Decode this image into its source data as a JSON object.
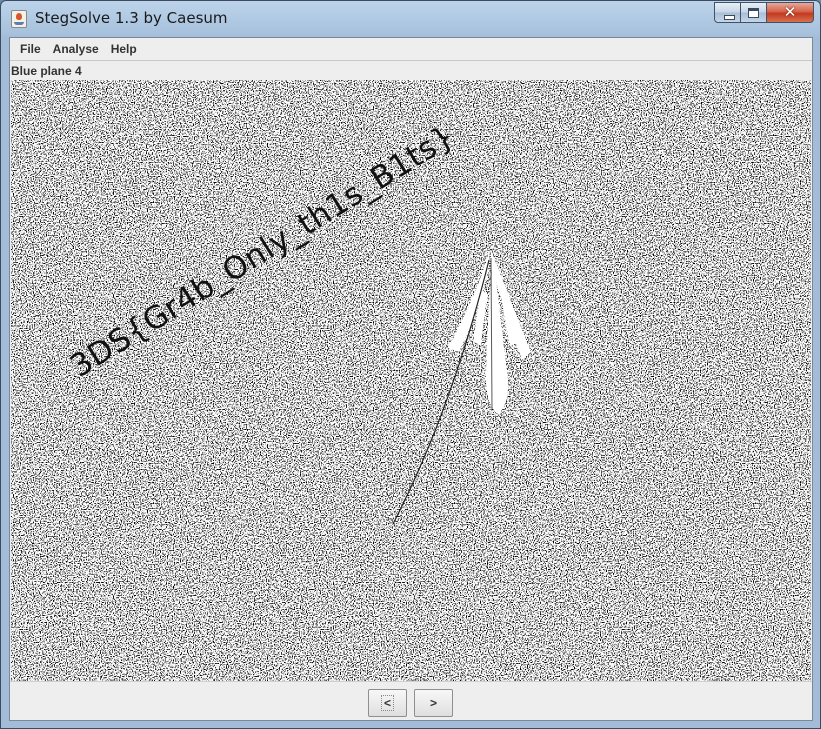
{
  "window": {
    "title": "StegSolve 1.3 by Caesum",
    "close_glyph": "✕"
  },
  "menubar": {
    "items": [
      "File",
      "Analyse",
      "Help"
    ]
  },
  "view": {
    "plane_label": "Blue plane 4",
    "hidden_text": "3DS{Gr4b_Only_th1s_B1ts}"
  },
  "navigation": {
    "prev_label": "<",
    "next_label": ">"
  },
  "colors": {
    "noise_dark": "#000000",
    "noise_light": "#ffffff",
    "window_frame": "#a9c3de",
    "close_button": "#c4391f"
  }
}
